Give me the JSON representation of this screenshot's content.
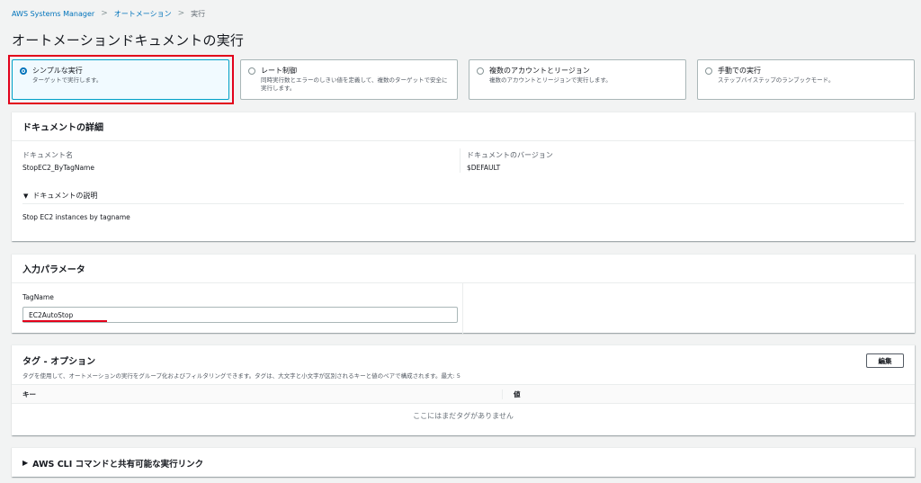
{
  "breadcrumb": {
    "items": [
      "AWS Systems Manager",
      "オートメーション"
    ],
    "current": "実行",
    "separator": ">"
  },
  "page": {
    "title": "オートメーションドキュメントの実行"
  },
  "modes": [
    {
      "title": "シンプルな実行",
      "desc": "ターゲットで実行します。",
      "selected": true
    },
    {
      "title": "レート制御",
      "desc": "同時実行数とエラーのしきい値を定義して、複数のターゲットで安全に実行します。",
      "selected": false
    },
    {
      "title": "複数のアカウントとリージョン",
      "desc": "複数のアカウントとリージョンで実行します。",
      "selected": false
    },
    {
      "title": "手動での実行",
      "desc": "ステップバイステップのランブックモード。",
      "selected": false
    }
  ],
  "doc_details": {
    "title": "ドキュメントの詳細",
    "name_label": "ドキュメント名",
    "name_value": "StopEC2_ByTagName",
    "version_label": "ドキュメントのバージョン",
    "version_value": "$DEFAULT",
    "desc_toggle": "ドキュメントの説明",
    "desc_text": "Stop EC2 instances by tagname"
  },
  "params": {
    "title": "入力パラメータ",
    "tagname_label": "TagName",
    "tagname_value": "EC2AutoStop"
  },
  "tags": {
    "title": "タグ - オプション",
    "desc": "タグを使用して、オートメーションの実行をグループ化およびフィルタリングできます。タグは、大文字と小文字が区別されるキーと値のペアで構成されます。最大: 5",
    "edit_label": "編集",
    "col_key": "キー",
    "col_value": "値",
    "empty": "ここにはまだタグがありません"
  },
  "cli": {
    "title": "AWS CLI コマンドと共有可能な実行リンク"
  },
  "colors": {
    "highlight": "#e2001a",
    "link": "#0073bb",
    "selected_bg": "#f1faff"
  }
}
